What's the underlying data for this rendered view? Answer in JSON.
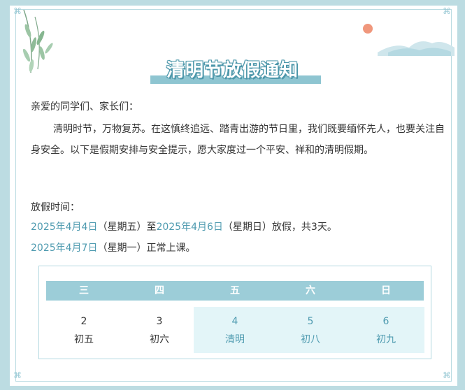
{
  "title": "清明节放假通知",
  "greeting": "亲爱的同学们、家长们：",
  "paragraph": "清明时节，万物复苏。在这慎终追远、踏青出游的节日里，我们既要缅怀先人，也要关注自身安全。以下是假期安排与安全提示，愿大家度过一个平安、祥和的清明假期。",
  "holiday_label": "放假时间：",
  "line1": {
    "start_date": "2025年4月4日",
    "start_weekday": "（星期五）至",
    "end_date": "2025年4月6日",
    "end_rest": "（星期日）放假，共3天。"
  },
  "line2": {
    "date": "2025年4月7日",
    "rest": "（星期一）正常上课。"
  },
  "calendar": {
    "headers": [
      "三",
      "四",
      "五",
      "六",
      "日"
    ],
    "days": [
      {
        "num": "2",
        "lunar": "初五"
      },
      {
        "num": "3",
        "lunar": "初六"
      },
      {
        "num": "4",
        "lunar": "清明"
      },
      {
        "num": "5",
        "lunar": "初八"
      },
      {
        "num": "6",
        "lunar": "初九"
      }
    ]
  },
  "colors": {
    "accent": "#4f9bb0",
    "header_bg": "#9ccdd8",
    "highlight_bg": "#e3f5f8",
    "page_bg": "#bcdce2"
  }
}
